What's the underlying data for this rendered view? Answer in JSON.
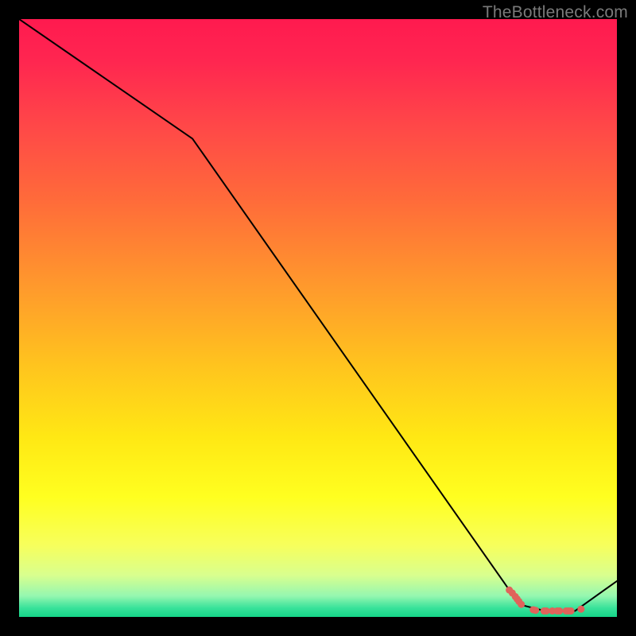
{
  "attribution": "TheBottleneck.com",
  "colors": {
    "gradient_stops": [
      {
        "offset": 0,
        "color": "#ff1a4f"
      },
      {
        "offset": 0.07,
        "color": "#ff2650"
      },
      {
        "offset": 0.18,
        "color": "#ff4848"
      },
      {
        "offset": 0.3,
        "color": "#ff6a3a"
      },
      {
        "offset": 0.45,
        "color": "#ff9a2c"
      },
      {
        "offset": 0.58,
        "color": "#ffc41e"
      },
      {
        "offset": 0.7,
        "color": "#ffe814"
      },
      {
        "offset": 0.8,
        "color": "#ffff20"
      },
      {
        "offset": 0.88,
        "color": "#f7ff5c"
      },
      {
        "offset": 0.93,
        "color": "#d9ff8e"
      },
      {
        "offset": 0.965,
        "color": "#95f7b0"
      },
      {
        "offset": 0.985,
        "color": "#38e29a"
      },
      {
        "offset": 1.0,
        "color": "#15d488"
      }
    ],
    "line": "#000000",
    "marker": "#e0635b"
  },
  "chart_data": {
    "type": "line",
    "title": "",
    "xlabel": "",
    "ylabel": "",
    "xlim": [
      0,
      100
    ],
    "ylim": [
      0,
      100
    ],
    "x": [
      0,
      29,
      82,
      84,
      88,
      89,
      90,
      93,
      100
    ],
    "y": [
      100,
      80,
      4.5,
      2,
      1,
      1,
      1,
      1,
      6
    ],
    "markers": {
      "x": [
        82.0,
        82.5,
        83.0,
        83.3,
        83.6,
        84.0,
        86.0,
        86.4,
        87.8,
        88.2,
        89.2,
        90.0,
        90.4,
        91.5,
        91.9,
        92.3,
        94.0
      ],
      "y": [
        4.5,
        4.0,
        3.4,
        3.0,
        2.6,
        2.1,
        1.2,
        1.1,
        1.0,
        1.0,
        1.0,
        1.0,
        1.0,
        1.0,
        1.0,
        1.0,
        1.3
      ]
    }
  }
}
